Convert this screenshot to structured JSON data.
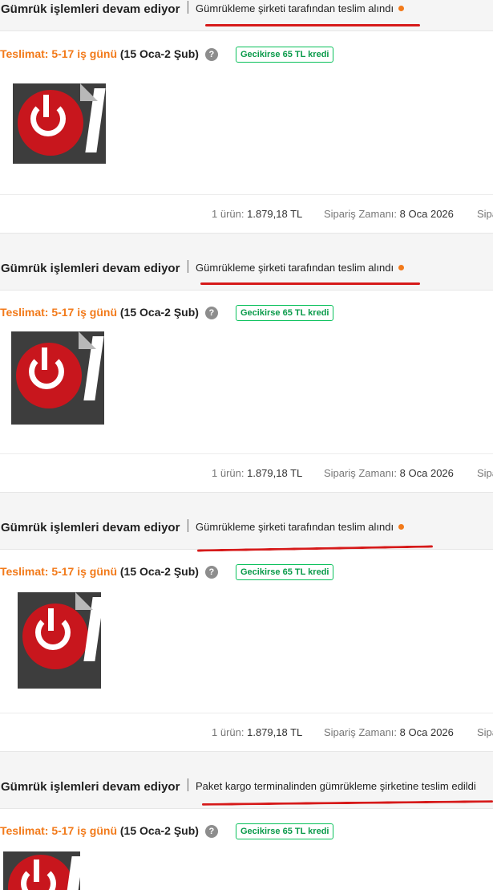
{
  "orders": [
    {
      "status_title": "Gümrük işlemleri devam ediyor",
      "status_detail": "Gümrükleme şirketi tarafından teslim alındı",
      "delivery_label": "Teslimat: 5-17 iş günü",
      "delivery_range": "(15 Oca-2 Şub)",
      "credit_badge": "Gecikirse 65 TL kredi",
      "item_count_label": "1 ürün:",
      "item_total": "1.879,18 TL",
      "order_time_label": "Sipariş Zamanı:",
      "order_time_value": "8 Oca 2026",
      "order_time_cut": "Sipa"
    },
    {
      "status_title": "Gümrük işlemleri devam ediyor",
      "status_detail": "Gümrükleme şirketi tarafından teslim alındı",
      "delivery_label": "Teslimat: 5-17 iş günü",
      "delivery_range": "(15 Oca-2 Şub)",
      "credit_badge": "Gecikirse 65 TL kredi",
      "item_count_label": "1 ürün:",
      "item_total": "1.879,18 TL",
      "order_time_label": "Sipariş Zamanı:",
      "order_time_value": "8 Oca 2026",
      "order_time_cut": "Sipa"
    },
    {
      "status_title": "Gümrük işlemleri devam ediyor",
      "status_detail": "Gümrükleme şirketi tarafından teslim alındı",
      "delivery_label": "Teslimat: 5-17 iş günü",
      "delivery_range": "(15 Oca-2 Şub)",
      "credit_badge": "Gecikirse 65 TL kredi",
      "item_count_label": "1 ürün:",
      "item_total": "1.879,18 TL",
      "order_time_label": "Sipariş Zamanı:",
      "order_time_value": "8 Oca 2026",
      "order_time_cut": "Sipa"
    },
    {
      "status_title": "Gümrük işlemleri devam ediyor",
      "status_detail": "Paket kargo terminalinden gümrükleme şirketine teslim edildi",
      "delivery_label": "Teslimat: 5-17 iş günü",
      "delivery_range": "(15 Oca-2 Şub)",
      "credit_badge": "Gecikirse 65 TL kredi"
    }
  ],
  "colors": {
    "accent_orange": "#f27a1a",
    "annotation_red": "#d61a1a",
    "credit_green": "#0a9a4a"
  },
  "icons": {
    "help": "question-mark-circle-icon",
    "status_dot": "orange-dot-icon"
  }
}
